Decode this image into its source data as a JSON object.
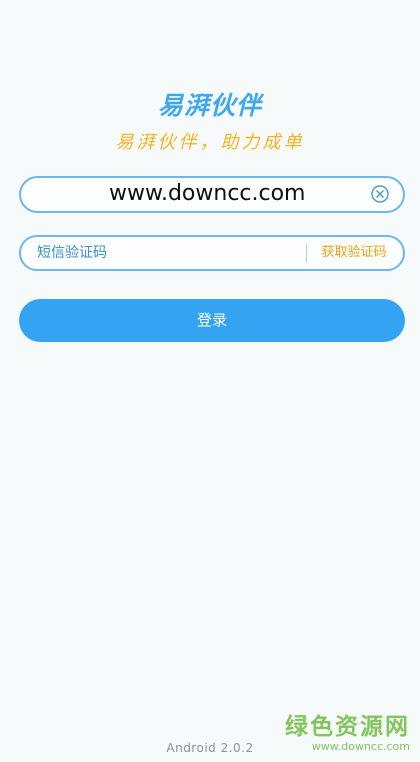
{
  "header": {
    "logo_text": "易湃伙伴",
    "slogan": "易湃伙伴，助力成单"
  },
  "form": {
    "phone_value": "www.downcc.com",
    "clear_icon": "circle-x-icon",
    "code_placeholder": "短信验证码",
    "get_code_label": "获取验证码",
    "login_label": "登录"
  },
  "footer": {
    "version": "Android 2.0.2"
  },
  "watermark": {
    "title": "绿色资源网",
    "url": "www.downcc.com"
  },
  "colors": {
    "accent": "#33a3f2",
    "slogan": "#f2b51f",
    "get_code": "#e8a412",
    "watermark": "#76c04a",
    "background": "#f6fafb"
  }
}
